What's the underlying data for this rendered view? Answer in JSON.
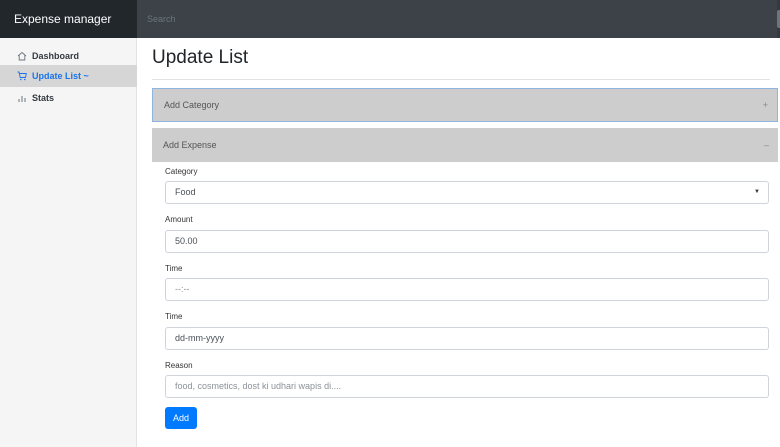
{
  "navbar": {
    "brand": "Expense manager",
    "search_placeholder": "Search"
  },
  "sidebar": {
    "items": [
      {
        "label": "Dashboard",
        "icon": "home-icon",
        "active": false
      },
      {
        "label": "Update List ~",
        "icon": "cart-icon",
        "active": true
      },
      {
        "label": "Stats",
        "icon": "bar-chart-icon",
        "active": false
      }
    ]
  },
  "page": {
    "title": "Update List"
  },
  "accordion": {
    "add_category": {
      "label": "Add Category",
      "sign": "+"
    },
    "add_expense": {
      "label": "Add Expense",
      "sign": "–"
    }
  },
  "form": {
    "category": {
      "label": "Category",
      "value": "Food"
    },
    "amount": {
      "label": "Amount",
      "value": "50.00"
    },
    "time": {
      "label": "Time",
      "placeholder": "--:--"
    },
    "date": {
      "label": "Time",
      "placeholder": "dd-mm-yyyy"
    },
    "reason": {
      "label": "Reason",
      "placeholder": "food, cosmetics, dost ki udhari wapis di...."
    },
    "submit_label": "Add"
  },
  "colors": {
    "navbar": "#343a40",
    "accent": "#007bff",
    "active_link": "#1a73e8"
  }
}
